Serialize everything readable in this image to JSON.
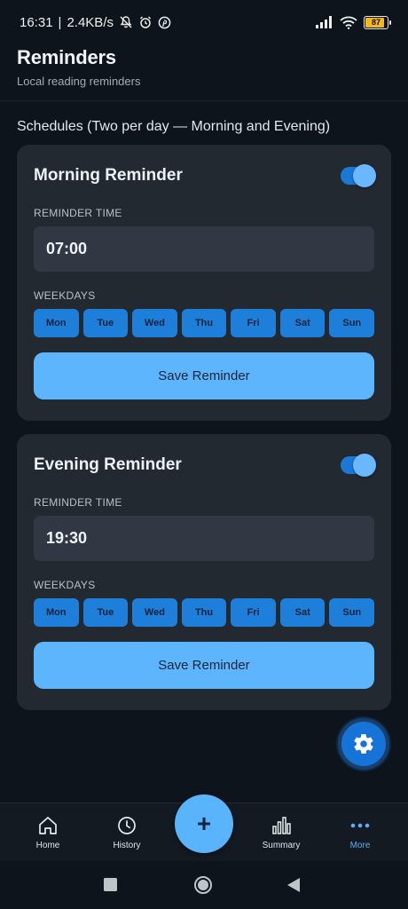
{
  "status_bar": {
    "time": "16:31",
    "net_speed": "2.4KB/s",
    "battery": "87",
    "battery_level": 0.87,
    "icons": [
      "mute-icon",
      "alarm-icon",
      "pinterest-icon",
      "signal-icon",
      "wifi-icon",
      "battery-icon"
    ]
  },
  "header": {
    "title": "Reminders",
    "subtitle": "Local reading reminders"
  },
  "section_title": "Schedules (Two per day — Morning and Evening)",
  "cards": [
    {
      "title": "Morning Reminder",
      "enabled": true,
      "time_label": "REMINDER TIME",
      "time": "07:00",
      "weekdays_label": "WEEKDAYS",
      "days": [
        "Mon",
        "Tue",
        "Wed",
        "Thu",
        "Fri",
        "Sat",
        "Sun"
      ],
      "save_label": "Save Reminder"
    },
    {
      "title": "Evening Reminder",
      "enabled": true,
      "time_label": "REMINDER TIME",
      "time": "19:30",
      "weekdays_label": "WEEKDAYS",
      "days": [
        "Mon",
        "Tue",
        "Wed",
        "Thu",
        "Fri",
        "Sat",
        "Sun"
      ],
      "save_label": "Save Reminder"
    }
  ],
  "settings_fab": {
    "icon": "gear-icon"
  },
  "bottom_nav": {
    "items": [
      {
        "label": "Home",
        "icon": "home-icon"
      },
      {
        "label": "History",
        "icon": "clock-icon"
      },
      {
        "label": "Summary",
        "icon": "bar-chart-icon"
      },
      {
        "label": "More",
        "icon": "more-icon"
      }
    ],
    "active": "More",
    "add_icon": "+"
  },
  "colors": {
    "background": "#0e141b",
    "card": "#232931",
    "accent": "#5ab4fb",
    "day_chip": "#1e7fdb"
  }
}
